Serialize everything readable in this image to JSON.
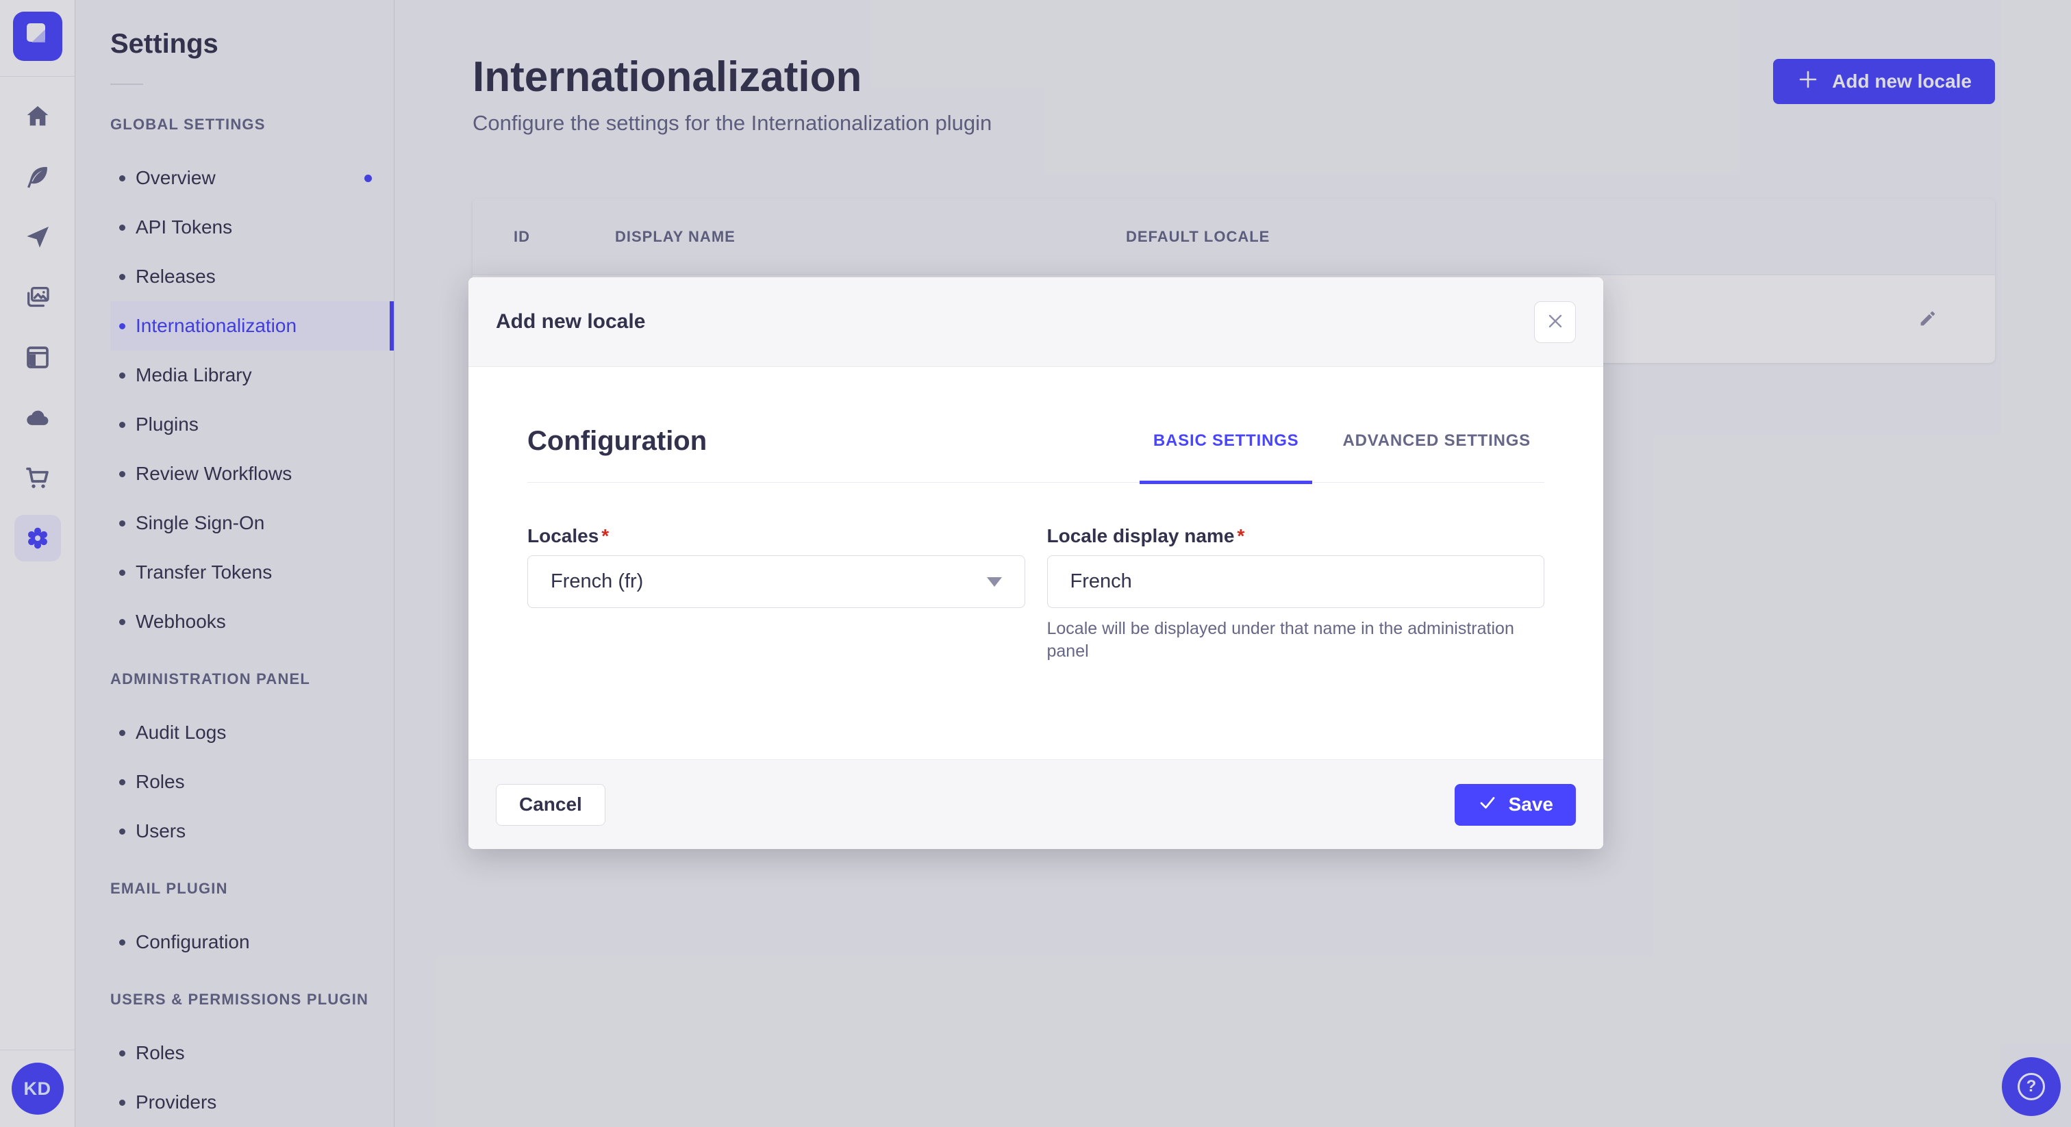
{
  "app": {
    "accent_color": "#4945ff",
    "avatar_initials": "KD",
    "help_label": "?",
    "rail_icons": [
      "strapi-logo",
      "home-icon",
      "feather-icon",
      "paper-plane-icon",
      "media-library-icon",
      "layout-icon",
      "cloud-icon",
      "marketplace-cart-icon",
      "settings-gear-icon"
    ]
  },
  "sidebar": {
    "title": "Settings",
    "sections": [
      {
        "label": "GLOBAL SETTINGS",
        "items": [
          {
            "label": "Overview",
            "notification_dot": true
          },
          {
            "label": "API Tokens"
          },
          {
            "label": "Releases"
          },
          {
            "label": "Internationalization",
            "active": true
          },
          {
            "label": "Media Library"
          },
          {
            "label": "Plugins"
          },
          {
            "label": "Review Workflows"
          },
          {
            "label": "Single Sign-On"
          },
          {
            "label": "Transfer Tokens"
          },
          {
            "label": "Webhooks"
          }
        ]
      },
      {
        "label": "ADMINISTRATION PANEL",
        "items": [
          {
            "label": "Audit Logs"
          },
          {
            "label": "Roles"
          },
          {
            "label": "Users"
          }
        ]
      },
      {
        "label": "EMAIL PLUGIN",
        "items": [
          {
            "label": "Configuration"
          }
        ]
      },
      {
        "label": "USERS & PERMISSIONS PLUGIN",
        "items": [
          {
            "label": "Roles"
          },
          {
            "label": "Providers"
          }
        ]
      }
    ]
  },
  "main": {
    "title": "Internationalization",
    "subtitle": "Configure the settings for the Internationalization plugin",
    "add_button_label": "Add new locale",
    "table": {
      "columns": [
        "ID",
        "DISPLAY NAME",
        "DEFAULT LOCALE"
      ]
    }
  },
  "modal": {
    "title": "Add new locale",
    "section_title": "Configuration",
    "tabs": [
      {
        "label": "BASIC SETTINGS",
        "active": true
      },
      {
        "label": "ADVANCED SETTINGS",
        "active": false
      }
    ],
    "form": {
      "required_mark": "*",
      "locales": {
        "label": "Locales",
        "value": "French (fr)"
      },
      "display_name": {
        "label": "Locale display name",
        "value": "French",
        "hint": "Locale will be displayed under that name in the administration panel"
      }
    },
    "cancel_label": "Cancel",
    "save_label": "Save"
  }
}
